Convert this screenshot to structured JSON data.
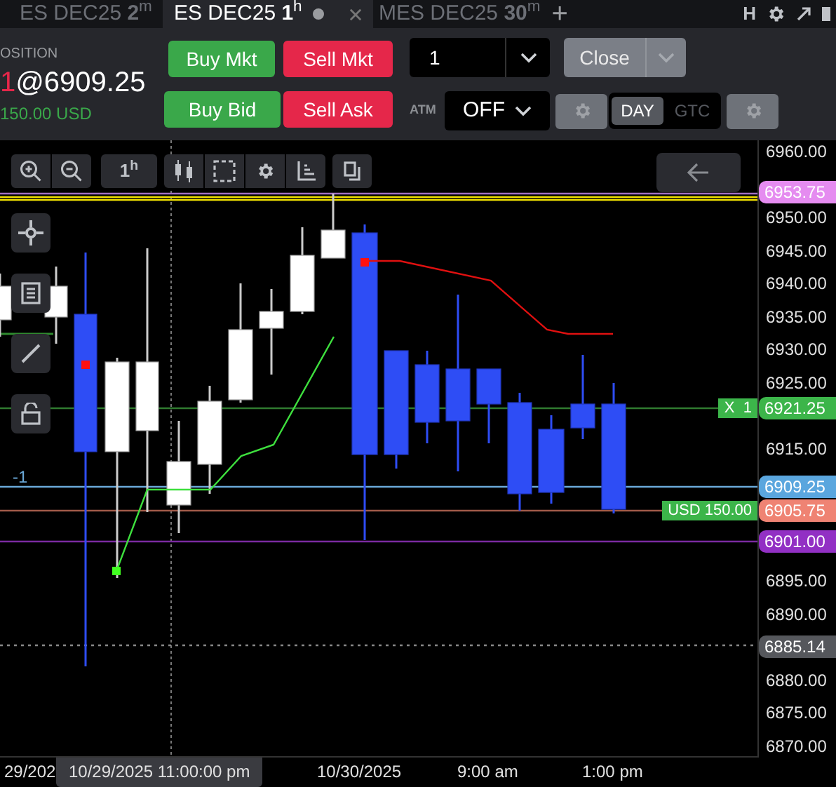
{
  "tabs": [
    {
      "label": "ES DEC25 **2**$^{m}$",
      "selected": false
    },
    {
      "label": "ES DEC25 **1**$^{h}$",
      "selected": true
    },
    {
      "label": "MES DEC25 **30**$^{m}$",
      "selected": false
    }
  ],
  "tab_bar": {
    "add": "+",
    "right_label": "H"
  },
  "position": {
    "label": "OSITION",
    "quantity": "1",
    "price": "@6909.25",
    "pnl": "150.00 USD"
  },
  "order_buttons": [
    {
      "label": "Buy Mkt",
      "kind": "buy"
    },
    {
      "label": "Sell Mkt",
      "kind": "sell"
    },
    {
      "label": "Buy Bid",
      "kind": "buy"
    },
    {
      "label": "Sell Ask",
      "kind": "sell"
    }
  ],
  "quantity_field": {
    "value": "1"
  },
  "close_button": {
    "label": "Close"
  },
  "atm": {
    "label": "ATM",
    "value": "OFF"
  },
  "time_in_force": [
    {
      "label": "DAY",
      "selected": true
    },
    {
      "label": "GTC",
      "selected": false
    }
  ],
  "chart": {
    "interval_button": "1$^{h}$",
    "price_axis": [
      "6960.00",
      "6950.00",
      "6945.00",
      "6940.00",
      "6935.00",
      "6930.00",
      "6925.00",
      "6915.00",
      "6895.00",
      "6890.00",
      "6880.00",
      "6875.00",
      "6870.00"
    ],
    "price_markers": [
      {
        "label": "6953.75",
        "color": "#e58cf0"
      },
      {
        "label": "6921.25",
        "color": "#3cb54a"
      },
      {
        "label": "6909.25",
        "color": "#5aa6de"
      },
      {
        "label": "6905.75",
        "color": "#ef8373"
      },
      {
        "label": "6901.00",
        "color": "#9230c4"
      },
      {
        "label": "6885.14",
        "color": "#55575c"
      }
    ],
    "order_labels": [
      "X  1",
      "USD 150.00"
    ],
    "position_label": "-1",
    "time_axis": [
      {
        "label": "29/202",
        "selected": false
      },
      {
        "label": "10/29/2025 11:00:00 pm",
        "selected": true
      },
      {
        "label": "10/30/2025",
        "selected": false
      },
      {
        "label": "9:00 am",
        "selected": false
      },
      {
        "label": "1:00 pm",
        "selected": false
      }
    ]
  }
}
